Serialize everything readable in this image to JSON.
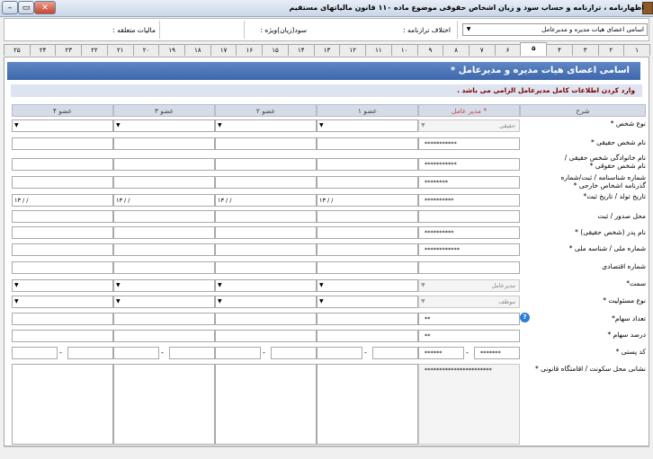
{
  "window": {
    "title": "اظهارنامه ، ترازنامه و حساب سود و زیان اشخاص حقوقی موضوع ماده ۱۱۰ قانون مالیاتهای مستقیم",
    "close_icon": "close-icon",
    "max_icon": "maximize-icon",
    "min_icon": "minimize-icon"
  },
  "header": {
    "select_value": "اسامی اعضای هیات مدیره و مدیرعامل",
    "ekhtelaf_label": "اختلاف ترازنامه :",
    "sood_label": "سود(زیان)ویژه :",
    "maliat_label": "مالیات متعلقه :"
  },
  "tabs": [
    "۱",
    "۲",
    "۳",
    "۴",
    "۵",
    "۶",
    "۷",
    "۸",
    "۹",
    "۱۰",
    "۱۱",
    "۱۲",
    "۱۳",
    "۱۴",
    "۱۵",
    "۱۶",
    "۱۷",
    "۱۸",
    "۱۹",
    "۲۰",
    "۲۱",
    "۲۲",
    "۲۳",
    "۲۴",
    "۲۵"
  ],
  "active_tab": "۵",
  "banner": "اسامی اعضای هیات مدیره و مدیرعامل *",
  "notice": "وارد کردن اطلاعات کامل مدیرعامل الزامی می باشد .",
  "columns": {
    "sharh": "شرح",
    "modir": "مدیر عامل *",
    "ozv1": "عضو ۱",
    "ozv2": "عضو ۲",
    "ozv3": "عضو ۳",
    "ozv4": "عضو ۴"
  },
  "rows": {
    "noe_shakhs": "نوع شخص *",
    "name": "نام شخص حقیقی *",
    "family1": "نام خانوادگی شخص حقیقی /",
    "family2": "نام شخص حقوقی *",
    "shenas1": "شماره شناسنامه / ثبت/شماره",
    "shenas2": "گذرنامه اشخاص خارجی *",
    "tarikh": "تاریخ تولد / تاریخ ثبت*",
    "mahal": "محل صدور / ثبت",
    "pedar": "نام پدر (شخص حقیقی) *",
    "melli": "شماره ملی / شناسه ملی *",
    "eghtesadi": "شماره اقتصادی",
    "semat": "سمت*",
    "masouliat": "نوع مسئولیت *",
    "tedad": "تعداد سهام*",
    "darsad": "درصد سهام *",
    "codeposti": "کد پستی *",
    "neshani": "نشانی محل سکونت / اقامتگاه قانونی *"
  },
  "values": {
    "noe_shakhs": "حقیقی",
    "name": "***********",
    "family": "***********",
    "shenas": "********",
    "tarikh": "**********",
    "date_placeholder": "۱۳ /  /",
    "pedar": "**********",
    "melli": "************",
    "semat": "مدیرعامل",
    "masouliat": "موظف",
    "tedad": "**",
    "darsad": "**",
    "codeposti_a": "*******",
    "codeposti_b": "******",
    "dash": "-",
    "neshani": "***********************"
  },
  "info_icon": "help-icon"
}
